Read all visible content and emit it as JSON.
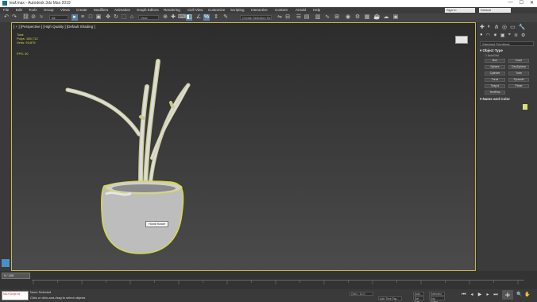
{
  "window": {
    "title": "leaf.max - Autodesk 3ds Max 2019",
    "controls": [
      "—",
      "☐",
      "✕"
    ]
  },
  "menu": [
    "File",
    "Edit",
    "Tools",
    "Group",
    "Views",
    "Create",
    "Modifiers",
    "Animation",
    "Graph Editors",
    "Rendering",
    "Civil View",
    "Customize",
    "Scripting",
    "Interactive",
    "Content",
    "Arnold",
    "Help"
  ],
  "account": {
    "signin": "Sign In",
    "workspace": "Default"
  },
  "toolbar": {
    "filter": "All",
    "view": "View",
    "selection_set": "Create Selection Se"
  },
  "viewport": {
    "label": "[ + ] [Perspective ] [High Quality ] [Default Shading ]",
    "stats": [
      "Total",
      "Polys: 185,713",
      "Verts: 93,876"
    ],
    "fps": "FPS: 30",
    "tooltip": "Home flower"
  },
  "command_panel": {
    "dropdown": "Standard Primitives",
    "object_type_label": "Object Type",
    "autogrid_label": "AutoGrid",
    "buttons": [
      "Box",
      "Cone",
      "Sphere",
      "GeoSphere",
      "Cylinder",
      "Tube",
      "Torus",
      "Pyramid",
      "Teapot",
      "Plane",
      "TextPlus"
    ],
    "name_color_label": "Name and Color",
    "swatch_color": "#d8e07a"
  },
  "timeline": {
    "frame_label": "0 / 100"
  },
  "status": {
    "maxscript": "MAXScript Mi",
    "line1": "None Selected",
    "line2": "Click or click-and-drag to select objects",
    "grid": "Grid = 10.0",
    "add_time_tag": "Add Time Tag",
    "auto": "Auto",
    "set_key": "Set Key",
    "selected": "Selected",
    "key_filters": "Key Filters..."
  },
  "colors": {
    "selection_outline": "#d8d84a",
    "accent": "#5a7fa6"
  }
}
